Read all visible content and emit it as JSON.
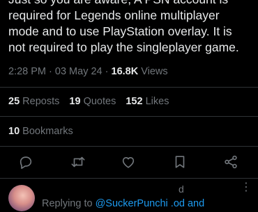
{
  "tweet": {
    "lines": [
      "Just so you are aware, A PSN account is",
      "required for Legends online multiplayer",
      "mode and to use PlayStation overlay. It is",
      "not required to play the singleplayer game."
    ]
  },
  "meta": {
    "time": "2:28 PM",
    "sep1": " · ",
    "date": "03 May 24",
    "sep2": " · ",
    "views_count": "16.8K",
    "views_label": " Views"
  },
  "stats": {
    "reposts_count": "25",
    "reposts_label": "Reposts",
    "quotes_count": "19",
    "quotes_label": "Quotes",
    "likes_count": "152",
    "likes_label": "Likes",
    "bookmarks_count": "10",
    "bookmarks_label": "Bookmarks"
  },
  "actions": {
    "reply": "reply-icon",
    "repost": "repost-icon",
    "like": "heart-icon",
    "bookmark": "bookmark-icon",
    "share": "share-icon"
  },
  "reply": {
    "name_fragment": "d",
    "more": "⋮",
    "replying_prefix": "Replying to ",
    "mention": "@SuckerPunchi",
    "mention_rest": " .od and"
  },
  "colors": {
    "background": "#000000",
    "text": "#e7e9ea",
    "secondary": "#71767b",
    "link": "#1d9bf0",
    "divider": "#2f3336"
  }
}
